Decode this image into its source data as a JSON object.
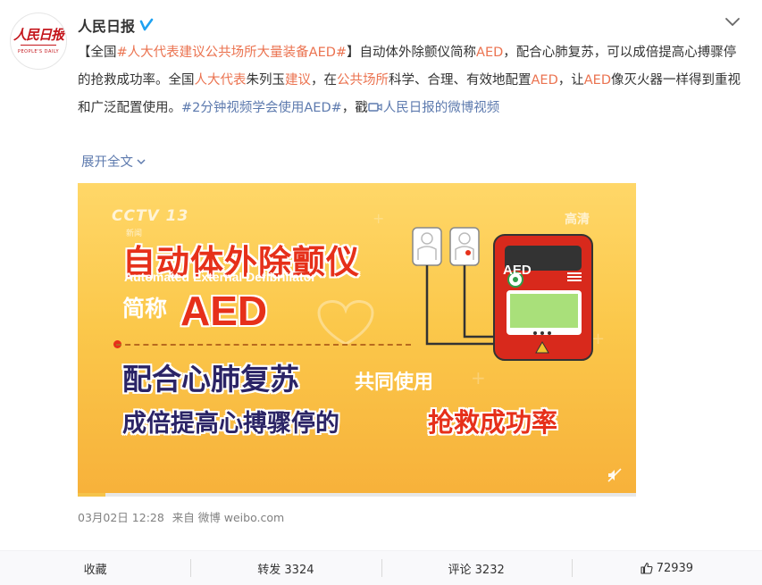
{
  "account": {
    "name": "人民日报",
    "avatar_logo_cn": "人民日报",
    "avatar_logo_en": "PEOPLE'S DAILY"
  },
  "post": {
    "seg1": "【全国",
    "tag1": "#人大代表建议公共场所大量装备AED#",
    "seg2": "】自动体外除颤仪简称",
    "hl_aed1": "AED",
    "seg3": "，配合心肺复苏，可以成倍提高心搏骤停的抢救成功率。全国",
    "hl_rdb": "人大代表",
    "seg4": "朱列玉",
    "hl_jy": "建议",
    "seg5": "，在",
    "hl_ggcs": "公共场所",
    "seg6": "科学、合理、有效地配置",
    "hl_aed2": "AED",
    "seg7": "，让",
    "hl_aed3": "AED",
    "seg8": "像灭火器一样得到重视和广泛配置使用。",
    "tag2": "#2分钟视频学会使用AED#",
    "seg9": "，戳",
    "video_link": "人民日报的微博视频",
    "expand_label": "展开全文"
  },
  "video": {
    "channel": "CCTV 13",
    "channel_sub": "新闻",
    "hd_label": "高清",
    "title_cn": "自动体外除颤仪",
    "title_en": "Automated External Defibrillator",
    "abbr_prefix": "简称",
    "abbr": "AED",
    "line3": "配合心肺复苏",
    "line3_suffix": "共同使用",
    "line4": "成倍提高心搏骤停的",
    "line4_highlight": "抢救成功率",
    "device_label": "AED",
    "progress": 0.05
  },
  "meta": {
    "time": "03月02日 12:28",
    "source": "来自 微博 weibo.com"
  },
  "actions": {
    "favorite": "收藏",
    "repost": "转发 3324",
    "comment": "评论 3232",
    "like": "72939"
  },
  "colors": {
    "highlight": "#eb7350",
    "link": "#5d7aae",
    "verify": "#1ea1f1"
  }
}
